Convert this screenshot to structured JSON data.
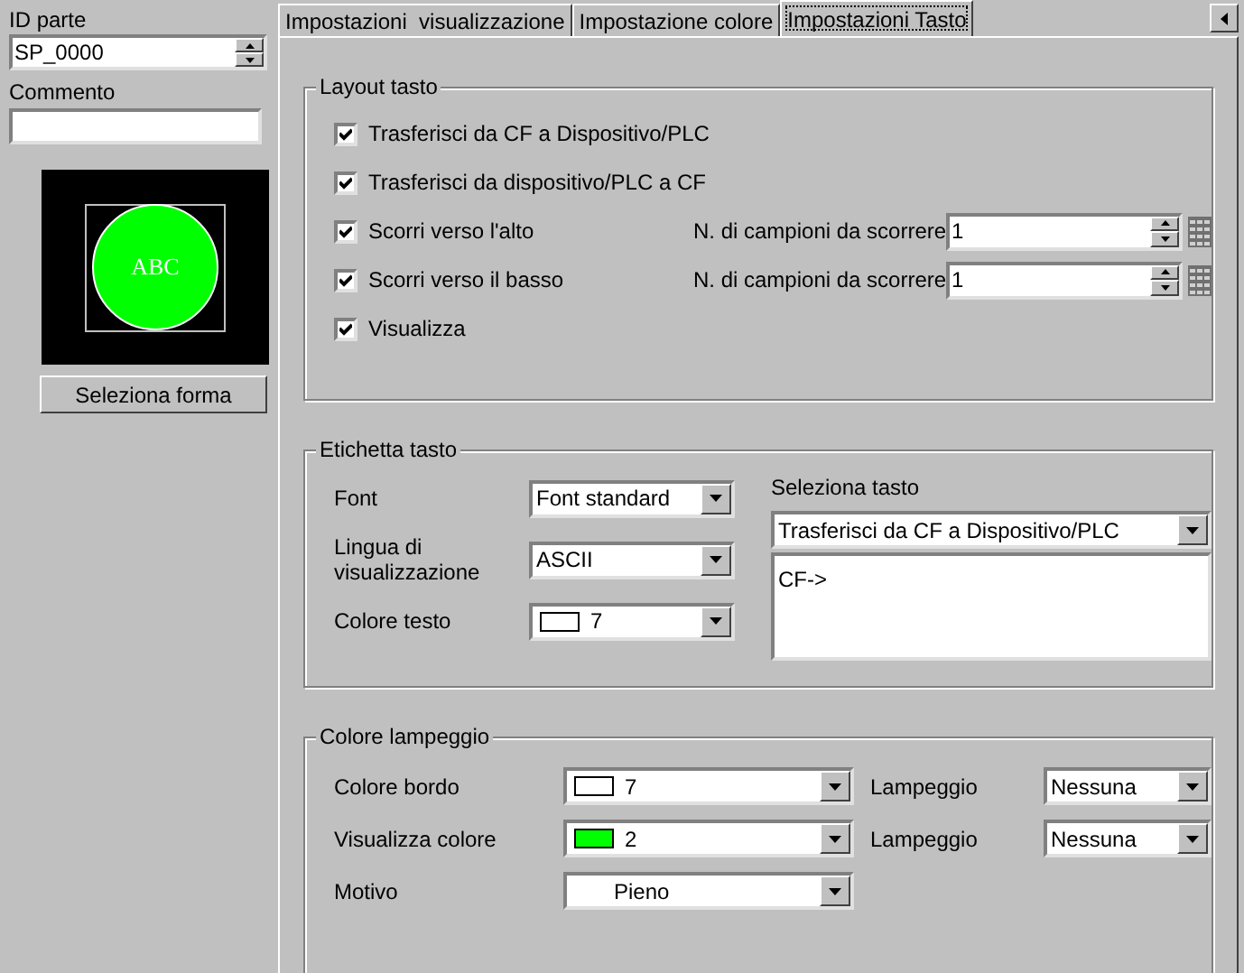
{
  "left": {
    "id_label": "ID parte",
    "id_value": "SP_0000",
    "comment_label": "Commento",
    "preview_text": "ABC",
    "shape_button": "Seleziona forma"
  },
  "tabs": [
    {
      "label": "Impostazioni  visualizzazione",
      "selected": false
    },
    {
      "label": "Impostazione colore",
      "selected": false
    },
    {
      "label": "Impostazioni Tasto",
      "selected": true
    }
  ],
  "layout_group": {
    "title": "Layout tasto",
    "rows": [
      {
        "label": "Trasferisci da CF a Dispositivo/PLC",
        "checked": true
      },
      {
        "label": "Trasferisci da dispositivo/PLC a CF",
        "checked": true
      },
      {
        "label": "Scorri verso l'alto",
        "checked": true,
        "spin_label": "N. di campioni da scorrere",
        "spin_value": "1"
      },
      {
        "label": "Scorri verso il basso",
        "checked": true,
        "spin_label": "N. di campioni da scorrere",
        "spin_value": "1"
      },
      {
        "label": "Visualizza",
        "checked": true
      }
    ]
  },
  "label_group": {
    "title": "Etichetta tasto",
    "fields": [
      {
        "label": "Font",
        "kind": "select",
        "value": "Font standard"
      },
      {
        "label": "Lingua di visualizzazione",
        "kind": "select",
        "value": "ASCII"
      },
      {
        "label": "Colore testo",
        "kind": "color",
        "value": "7",
        "color": "#ffffff"
      }
    ],
    "key_select_label": "Seleziona tasto",
    "key_select_value": "Trasferisci da CF a Dispositivo/PLC",
    "key_text": "CF->"
  },
  "blink_group": {
    "title": "Colore lampeggio",
    "rows": [
      {
        "label": "Colore bordo",
        "kind": "color",
        "value": "7",
        "color": "#ffffff",
        "blink_label": "Lampeggio",
        "blink_value": "Nessuna"
      },
      {
        "label": "Visualizza colore",
        "kind": "color",
        "value": "2",
        "color": "#00ff00",
        "blink_label": "Lampeggio",
        "blink_value": "Nessuna"
      },
      {
        "label": "Motivo",
        "kind": "pattern",
        "value": "Pieno"
      }
    ]
  }
}
